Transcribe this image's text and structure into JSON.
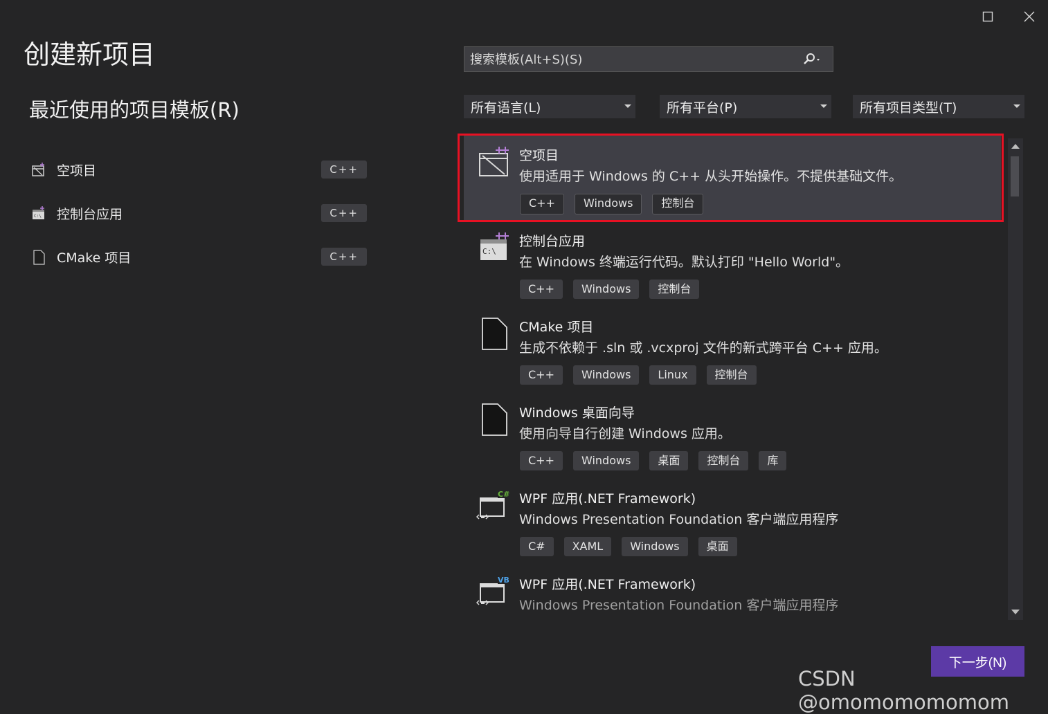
{
  "window": {
    "maximize_icon": "maximize-icon",
    "close_icon": "close-icon"
  },
  "title": "创建新项目",
  "recent": {
    "heading": "最近使用的项目模板(R)",
    "items": [
      {
        "label": "空项目",
        "tag": "C++",
        "icon": "empty-project-icon"
      },
      {
        "label": "控制台应用",
        "tag": "C++",
        "icon": "console-app-icon"
      },
      {
        "label": "CMake 项目",
        "tag": "C++",
        "icon": "document-icon"
      }
    ]
  },
  "search": {
    "placeholder": "搜索模板(Alt+S)(S)",
    "icon": "search-icon"
  },
  "filters": {
    "language": "所有语言(L)",
    "platform": "所有平台(P)",
    "project_type": "所有项目类型(T)"
  },
  "templates": [
    {
      "name": "空项目",
      "description": "使用适用于 Windows 的 C++ 从头开始操作。不提供基础文件。",
      "tags": [
        "C++",
        "Windows",
        "控制台"
      ],
      "icon": "empty-project-icon",
      "selected": true
    },
    {
      "name": "控制台应用",
      "description": "在 Windows 终端运行代码。默认打印 \"Hello World\"。",
      "tags": [
        "C++",
        "Windows",
        "控制台"
      ],
      "icon": "console-app-icon"
    },
    {
      "name": "CMake 项目",
      "description": "生成不依赖于 .sln 或 .vcxproj 文件的新式跨平台 C++ 应用。",
      "tags": [
        "C++",
        "Windows",
        "Linux",
        "控制台"
      ],
      "icon": "document-icon"
    },
    {
      "name": "Windows 桌面向导",
      "description": "使用向导自行创建 Windows 应用。",
      "tags": [
        "C++",
        "Windows",
        "桌面",
        "控制台",
        "库"
      ],
      "icon": "document-icon"
    },
    {
      "name": "WPF 应用(.NET Framework)",
      "description": "Windows Presentation Foundation 客户端应用程序",
      "tags": [
        "C#",
        "XAML",
        "Windows",
        "桌面"
      ],
      "icon": "wpf-csharp-icon"
    },
    {
      "name": "WPF 应用(.NET Framework)",
      "description": "Windows Presentation Foundation 客户端应用程序",
      "tags": [],
      "icon": "wpf-vb-icon"
    }
  ],
  "next_button": "下一步(N)",
  "watermark": "CSDN @omomomomomom",
  "colors": {
    "background": "#252526",
    "selected": "#3f3f46",
    "highlight": "#e81123",
    "accent": "#5c3aa6"
  }
}
